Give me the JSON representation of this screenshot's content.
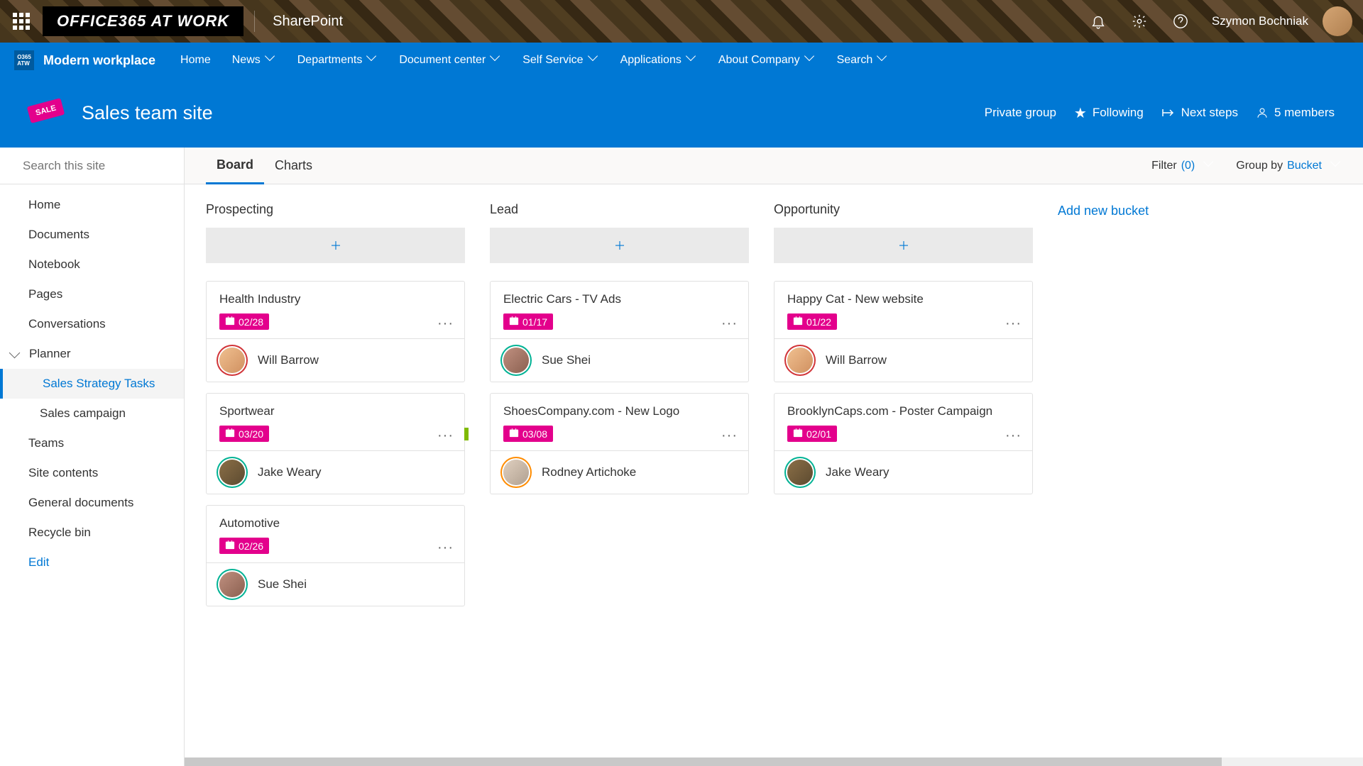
{
  "suite": {
    "brand": "OFFICE365 AT WORK",
    "app": "SharePoint",
    "user": "Szymon Bochniak"
  },
  "hub": {
    "title": "Modern workplace",
    "links": [
      "Home",
      "News",
      "Departments",
      "Document center",
      "Self Service",
      "Applications",
      "About Company",
      "Search"
    ]
  },
  "site": {
    "title": "Sales team site",
    "privacy": "Private group",
    "following": "Following",
    "next_steps": "Next steps",
    "members": "5 members"
  },
  "search": {
    "placeholder": "Search this site"
  },
  "nav": {
    "items": [
      "Home",
      "Documents",
      "Notebook",
      "Pages",
      "Conversations"
    ],
    "planner": "Planner",
    "planner_sub": [
      "Sales Strategy Tasks",
      "Sales campaign"
    ],
    "items2": [
      "Teams",
      "Site contents",
      "General documents",
      "Recycle bin"
    ],
    "edit": "Edit"
  },
  "tabs": {
    "board": "Board",
    "charts": "Charts"
  },
  "toolbar": {
    "filter_label": "Filter",
    "filter_count": "(0)",
    "group_label": "Group by",
    "group_value": "Bucket"
  },
  "buckets": [
    {
      "title": "Prospecting",
      "cards": [
        {
          "title": "Health Industry",
          "date": "02/28",
          "assignee": "Will Barrow",
          "avatar": "will",
          "ring": "red"
        },
        {
          "title": "Sportwear",
          "date": "03/20",
          "assignee": "Jake Weary",
          "avatar": "jake",
          "ring": "teal",
          "green": true
        },
        {
          "title": "Automotive",
          "date": "02/26",
          "assignee": "Sue Shei",
          "avatar": "sue",
          "ring": "teal"
        }
      ]
    },
    {
      "title": "Lead",
      "cards": [
        {
          "title": "Electric Cars - TV Ads",
          "date": "01/17",
          "assignee": "Sue Shei",
          "avatar": "sue",
          "ring": "teal"
        },
        {
          "title": "ShoesCompany.com - New Logo",
          "date": "03/08",
          "assignee": "Rodney Artichoke",
          "avatar": "rodney",
          "ring": "orange"
        }
      ]
    },
    {
      "title": "Opportunity",
      "cards": [
        {
          "title": "Happy Cat - New website",
          "date": "01/22",
          "assignee": "Will Barrow",
          "avatar": "will",
          "ring": "red"
        },
        {
          "title": "BrooklynCaps.com - Poster Campaign",
          "date": "02/01",
          "assignee": "Jake Weary",
          "avatar": "jake",
          "ring": "teal"
        }
      ]
    }
  ],
  "add_bucket": "Add new bucket"
}
